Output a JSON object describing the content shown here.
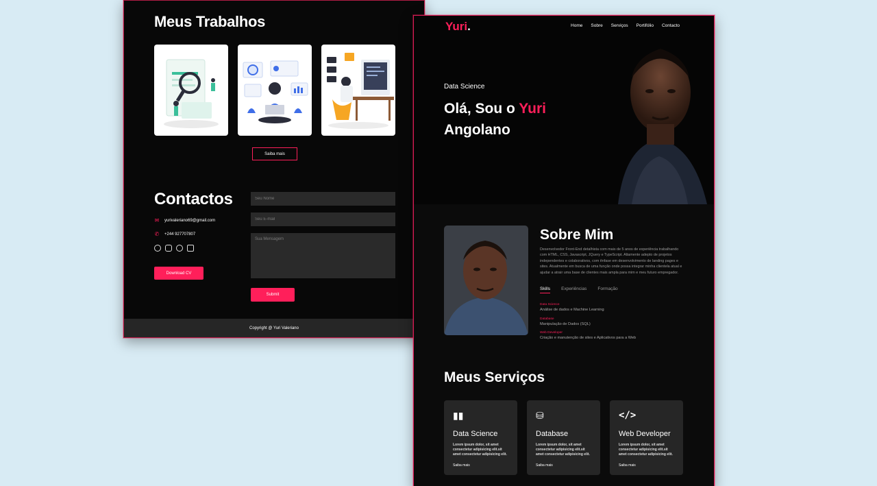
{
  "left_panel": {
    "works_title": "Meus Trabalhos",
    "works_button": "Saiba mais",
    "contact_title": "Contactos",
    "email": "yurivaleriano69@gmail.com",
    "phone": "+244 927707807",
    "socials": [
      "facebook-icon",
      "instagram-icon",
      "github-icon",
      "linkedin-icon"
    ],
    "download_button": "Download CV",
    "form": {
      "name_placeholder": "Seu Nome",
      "email_placeholder": "Seu E-mail",
      "message_placeholder": "Sua Mensagem",
      "submit_label": "Submit"
    },
    "footer": "Copyright @ Yuri Valeriano"
  },
  "right_panel": {
    "logo_text": "Yuri",
    "logo_dot": ".",
    "nav": [
      "Home",
      "Sobre",
      "Serviços",
      "Portifólio",
      "Contacto"
    ],
    "hero": {
      "subtitle": "Data Science",
      "greeting": "Olá, Sou o ",
      "name": "Yuri",
      "line2": "Angolano"
    },
    "about": {
      "title": "Sobre Mim",
      "text": "Desenvolvedor Front-End detalhista com mais de 5 anos de experiência trabalhando com HTML, CSS, Javascript, JQuery e TypeScript. Altamente adepto de projetos independentes e colaborativos, com ênfase em desenvolvimento de landing pages e sites. Atualmente em busca de uma função onde possa integrar minha clientela atual e ajudar a atrair uma base de clientes mais ampla para mim e meu futuro empregador.",
      "tabs": [
        "Skills",
        "Experiências",
        "Formação"
      ],
      "skills": [
        {
          "name": "Data Science",
          "desc": "Análise de dados e Machine Learning"
        },
        {
          "name": "Database",
          "desc": "Manipulação de Dados (SQL)"
        },
        {
          "name": "Web Developer",
          "desc": "Criação e manutenção de sites e Aplicativos para a Web"
        }
      ]
    },
    "services": {
      "title": "Meus Serviços",
      "items": [
        {
          "icon": "bar-chart-icon",
          "name": "Data Science",
          "desc": "Lorem ipsum dolor, sit amet consectetur adipisicing elit.sit amet consectetur adipisicing elit.",
          "link": "Saiba mais"
        },
        {
          "icon": "database-icon",
          "name": "Database",
          "desc": "Lorem ipsum dolor, sit amet consectetur adipisicing elit.sit amet consectetur adipisicing elit.",
          "link": "Saiba mais"
        },
        {
          "icon": "code-icon",
          "name": "Web Developer",
          "desc": "Lorem ipsum dolor, sit amet consectetur adipisicing elit.sit amet consectetur adipisicing elit.",
          "link": "Saiba mais"
        }
      ]
    }
  },
  "colors": {
    "accent": "#ff1f5a",
    "background": "#080808",
    "card": "#262626",
    "page_bg": "#d8ebf4"
  }
}
